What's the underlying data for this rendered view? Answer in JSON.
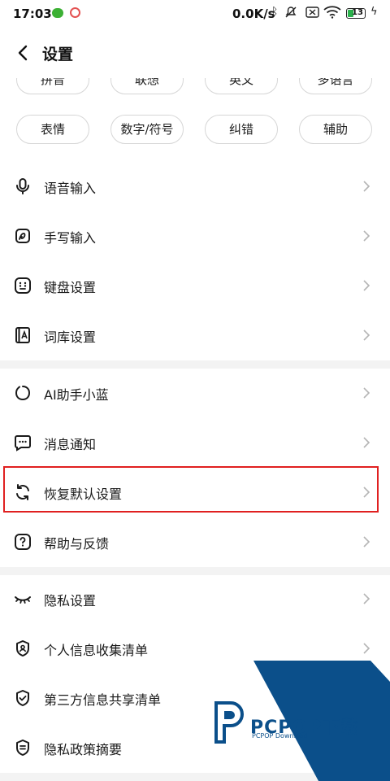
{
  "status_bar": {
    "time": "17:03",
    "network_speed": "0.0K/s",
    "battery_level": "13",
    "icons": [
      "wechat-icon",
      "app-icon",
      "bluetooth-icon",
      "mute-icon",
      "sim-off-icon",
      "wifi-icon",
      "battery-icon",
      "charging-icon"
    ]
  },
  "header": {
    "title": "设置",
    "back_icon": "chevron-left-icon"
  },
  "keyboard_chips_top": [
    "拼音",
    "联想",
    "英文",
    "多语言"
  ],
  "keyboard_chips": [
    "表情",
    "数字/符号",
    "纠错",
    "辅助"
  ],
  "section1": [
    {
      "label": "语音输入",
      "icon": "microphone-icon"
    },
    {
      "label": "手写输入",
      "icon": "handwriting-icon"
    },
    {
      "label": "键盘设置",
      "icon": "keyboard-icon"
    },
    {
      "label": "词库设置",
      "icon": "dictionary-icon"
    }
  ],
  "section2": [
    {
      "label": "AI助手小蓝",
      "icon": "ai-assistant-icon"
    },
    {
      "label": "消息通知",
      "icon": "message-icon"
    },
    {
      "label": "恢复默认设置",
      "icon": "reset-icon",
      "highlighted": true
    },
    {
      "label": "帮助与反馈",
      "icon": "help-icon"
    }
  ],
  "section3": [
    {
      "label": "隐私设置",
      "icon": "eye-closed-icon"
    },
    {
      "label": "个人信息收集清单",
      "icon": "personal-info-icon"
    },
    {
      "label": "第三方信息共享清单",
      "icon": "shield-check-icon"
    },
    {
      "label": "隐私政策摘要",
      "icon": "privacy-policy-icon"
    }
  ],
  "watermark": {
    "brand": "PCPOP下载",
    "sub": "PCPOP Download"
  },
  "colors": {
    "highlight": "#e02020",
    "separator": "#f3f3f3",
    "watermark_blue": "#0b4f8a"
  }
}
